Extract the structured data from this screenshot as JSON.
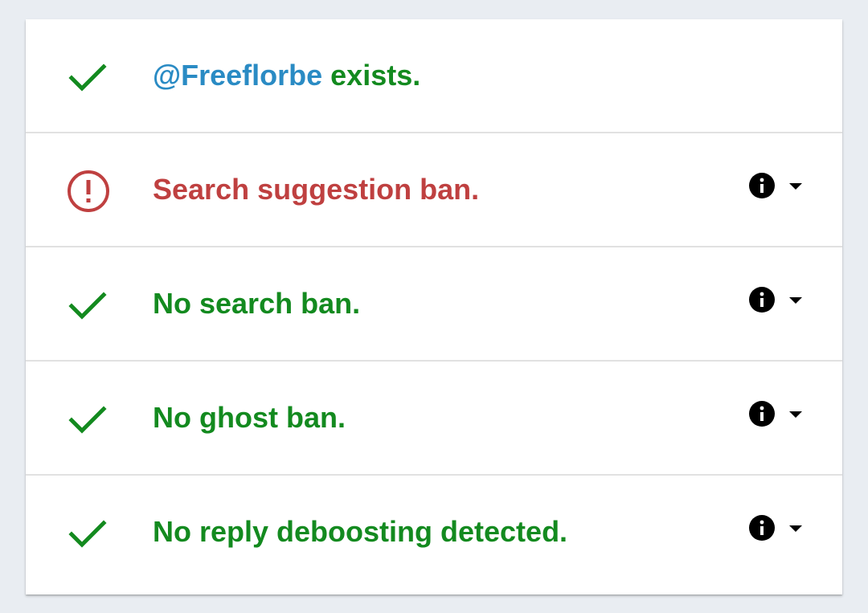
{
  "colors": {
    "success": "#138a1f",
    "error": "#bf4040",
    "handle": "#2a8bc4"
  },
  "results": [
    {
      "status": "success",
      "icon": "check-icon",
      "handle": "@Freeflorbe",
      "text": " exists.",
      "has_actions": false
    },
    {
      "status": "error",
      "icon": "alert-circle-icon",
      "text": "Search suggestion ban.",
      "has_actions": true
    },
    {
      "status": "success",
      "icon": "check-icon",
      "text": "No search ban.",
      "has_actions": true
    },
    {
      "status": "success",
      "icon": "check-icon",
      "text": "No ghost ban.",
      "has_actions": true
    },
    {
      "status": "success",
      "icon": "check-icon",
      "text": "No reply deboosting detected.",
      "has_actions": true
    }
  ]
}
